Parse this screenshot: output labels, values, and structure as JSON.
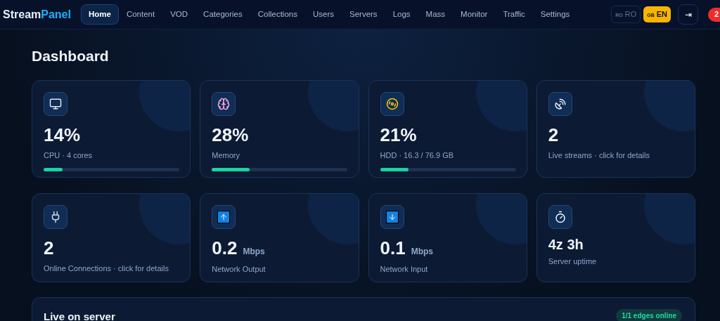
{
  "brand": {
    "first": "Stream",
    "second": "Panel"
  },
  "nav": [
    {
      "label": "Home",
      "selected": true
    },
    {
      "label": "Content",
      "selected": false
    },
    {
      "label": "VOD",
      "selected": false
    },
    {
      "label": "Categories",
      "selected": false
    },
    {
      "label": "Collections",
      "selected": false
    },
    {
      "label": "Users",
      "selected": false
    },
    {
      "label": "Servers",
      "selected": false
    },
    {
      "label": "Logs",
      "selected": false
    },
    {
      "label": "Mass",
      "selected": false
    },
    {
      "label": "Monitor",
      "selected": false
    },
    {
      "label": "Traffic",
      "selected": false
    },
    {
      "label": "Settings",
      "selected": false
    }
  ],
  "languages": [
    {
      "code": "RO",
      "label": "RO",
      "selected": false
    },
    {
      "code": "GB",
      "label": "EN",
      "selected": true
    }
  ],
  "logout": {
    "symbol": "⇥"
  },
  "notification_count": "2",
  "page_title": "Dashboard",
  "stats": [
    {
      "kind": "bar",
      "value": "14%",
      "label": "CPU · 4 cores",
      "level": 0.14
    },
    {
      "kind": "bar",
      "value": "28%",
      "label": "Memory",
      "level": 0.28
    },
    {
      "kind": "bar",
      "value": "21%",
      "label": "HDD · 16.3 / 76.9 GB",
      "level": 0.21
    },
    {
      "kind": "plain",
      "value": "2",
      "label": "Live streams · click for details"
    },
    {
      "kind": "plain",
      "value": "2",
      "label": "Online Connections · click for details"
    },
    {
      "kind": "unit",
      "value": "0.2",
      "unit": "Mbps",
      "label": "Network Output"
    },
    {
      "kind": "unit",
      "value": "0.1",
      "unit": "Mbps",
      "label": "Network Input"
    },
    {
      "kind": "small",
      "value": "4z 3h",
      "label": "Server uptime"
    }
  ],
  "live_panel": {
    "title": "Live on server",
    "badge": "1/1 edges online"
  }
}
